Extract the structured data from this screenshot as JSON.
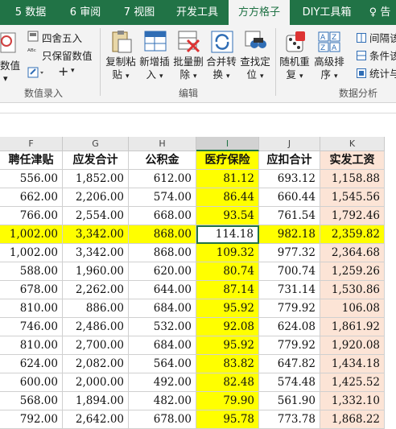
{
  "tabs": [
    {
      "label": "5 数据"
    },
    {
      "label": "6 审阅"
    },
    {
      "label": "7 视图"
    },
    {
      "label": "开发工具"
    },
    {
      "label": "方方格子"
    },
    {
      "label": "DIY工具箱"
    },
    {
      "label": "♀ 告"
    }
  ],
  "ribbon": {
    "round": "四舍五入",
    "keep_value": "只保留数值",
    "value_partial": "数值",
    "copy_paste": [
      "复制粘",
      "贴"
    ],
    "insert_add": [
      "新增插",
      "入"
    ],
    "batch_delete": [
      "批量删",
      "除"
    ],
    "merge_convert": [
      "合并转",
      "换"
    ],
    "find_locate": [
      "查找定",
      "位"
    ],
    "random_dup": [
      "随机重",
      "复"
    ],
    "advanced_sort": [
      "高级排",
      "序"
    ],
    "gap_select": "间隔该",
    "condition": "条件该",
    "stats": "统计与",
    "group_data_entry": "数值录入",
    "group_edit": "编辑",
    "group_analysis": "数据分析",
    "icon_names": [
      "document-icon",
      "abc-icon",
      "clipboard-icon",
      "table-insert-icon",
      "table-delete-icon",
      "merge-icon",
      "binoculars-icon",
      "dice-icon",
      "az-sort-icon",
      "grid-icon"
    ]
  },
  "columns": [
    {
      "letter": "F",
      "header": "聘任津贴",
      "tint": "none"
    },
    {
      "letter": "G",
      "header": "应发合计",
      "tint": "none"
    },
    {
      "letter": "H",
      "header": "公积金",
      "tint": "none"
    },
    {
      "letter": "I",
      "header": "医疗保险",
      "tint": "yellow"
    },
    {
      "letter": "J",
      "header": "应扣合计",
      "tint": "none"
    },
    {
      "letter": "K",
      "header": "实发工资",
      "tint": "peach"
    }
  ],
  "rows": [
    [
      "556.00",
      "1,852.00",
      "612.00",
      "81.12",
      "693.12",
      "1,158.88"
    ],
    [
      "662.00",
      "2,206.00",
      "574.00",
      "86.44",
      "660.44",
      "1,545.56"
    ],
    [
      "766.00",
      "2,554.00",
      "668.00",
      "93.54",
      "761.54",
      "1,792.46"
    ],
    [
      "1,002.00",
      "3,342.00",
      "868.00",
      "114.18",
      "982.18",
      "2,359.82"
    ],
    [
      "1,002.00",
      "3,342.00",
      "868.00",
      "109.32",
      "977.32",
      "2,364.68"
    ],
    [
      "588.00",
      "1,960.00",
      "620.00",
      "80.74",
      "700.74",
      "1,259.26"
    ],
    [
      "678.00",
      "2,262.00",
      "644.00",
      "87.14",
      "731.14",
      "1,530.86"
    ],
    [
      "810.00",
      "886.00",
      "684.00",
      "95.92",
      "779.92",
      "106.08"
    ],
    [
      "746.00",
      "2,486.00",
      "532.00",
      "92.08",
      "624.08",
      "1,861.92"
    ],
    [
      "810.00",
      "2,700.00",
      "684.00",
      "95.92",
      "779.92",
      "1,920.08"
    ],
    [
      "624.00",
      "2,082.00",
      "564.00",
      "83.82",
      "647.82",
      "1,434.18"
    ],
    [
      "600.00",
      "2,000.00",
      "492.00",
      "82.48",
      "574.48",
      "1,425.52"
    ],
    [
      "568.00",
      "1,894.00",
      "482.00",
      "79.90",
      "561.90",
      "1,332.10"
    ],
    [
      "792.00",
      "2,642.00",
      "678.00",
      "95.78",
      "773.78",
      "1,868.22"
    ]
  ],
  "highlight_row": 3,
  "active_cell": {
    "row": 3,
    "col": 3
  },
  "colors": {
    "accent": "#217346",
    "yellow": "#ffff00",
    "peach": "#fce4d6"
  }
}
